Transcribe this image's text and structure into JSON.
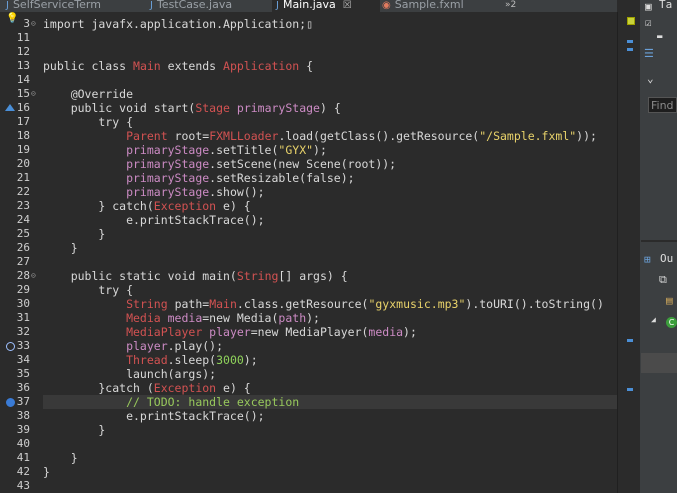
{
  "tabs": [
    {
      "label": "SelfServiceTerm",
      "icon": "java-file-icon",
      "active": false
    },
    {
      "label": "TestCase.java",
      "icon": "java-file-icon",
      "active": false
    },
    {
      "label": "Main.java",
      "icon": "java-file-icon",
      "active": true,
      "close": "☒"
    },
    {
      "label": "Sample.fxml",
      "icon": "fxml-file-icon",
      "active": false
    }
  ],
  "tab_overflow": "»2",
  "code": [
    {
      "n": "3",
      "fold": "⊝",
      "html": [
        [
          "kw",
          "import javafx.application.Application;"
        ],
        [
          "kw",
          "▯"
        ]
      ]
    },
    {
      "n": "11",
      "html": []
    },
    {
      "n": "12",
      "html": []
    },
    {
      "n": "13",
      "html": [
        [
          "kw",
          "public class "
        ],
        [
          "ty",
          "Main"
        ],
        [
          "kw",
          " extends "
        ],
        [
          "ty",
          "Application"
        ],
        [
          "kw",
          " {"
        ]
      ]
    },
    {
      "n": "14",
      "html": []
    },
    {
      "n": "15",
      "fold": "⊝",
      "html": [
        [
          "an",
          "    @Override"
        ]
      ]
    },
    {
      "n": "16",
      "html": [
        [
          "kw",
          "    public void start("
        ],
        [
          "ty",
          "Stage"
        ],
        [
          "kw",
          " "
        ],
        [
          "fd",
          "primaryStage"
        ],
        [
          "kw",
          ") {"
        ]
      ]
    },
    {
      "n": "17",
      "html": [
        [
          "kw",
          "        try {"
        ]
      ]
    },
    {
      "n": "18",
      "html": [
        [
          "kw",
          "            "
        ],
        [
          "ty",
          "Parent"
        ],
        [
          "kw",
          " root="
        ],
        [
          "ty",
          "FXMLLoader"
        ],
        [
          "kw",
          ".load(getClass().getResource("
        ],
        [
          "st",
          "\"/Sample.fxml\""
        ],
        [
          "kw",
          "));"
        ]
      ]
    },
    {
      "n": "19",
      "html": [
        [
          "fd",
          "            primaryStage"
        ],
        [
          "kw",
          ".setTitle("
        ],
        [
          "st",
          "\"GYX\""
        ],
        [
          "kw",
          ");"
        ]
      ]
    },
    {
      "n": "20",
      "html": [
        [
          "fd",
          "            primaryStage"
        ],
        [
          "kw",
          ".setScene(new Scene(root));"
        ]
      ]
    },
    {
      "n": "21",
      "html": [
        [
          "fd",
          "            primaryStage"
        ],
        [
          "kw",
          ".setResizable(false);"
        ]
      ]
    },
    {
      "n": "22",
      "html": [
        [
          "fd",
          "            primaryStage"
        ],
        [
          "kw",
          ".show();"
        ]
      ]
    },
    {
      "n": "23",
      "html": [
        [
          "kw",
          "        } catch("
        ],
        [
          "ty",
          "Exception"
        ],
        [
          "kw",
          " e) {"
        ]
      ]
    },
    {
      "n": "24",
      "html": [
        [
          "kw",
          "            e.printStackTrace();"
        ]
      ]
    },
    {
      "n": "25",
      "html": [
        [
          "kw",
          "        }"
        ]
      ]
    },
    {
      "n": "26",
      "html": [
        [
          "kw",
          "    }"
        ]
      ]
    },
    {
      "n": "27",
      "html": []
    },
    {
      "n": "28",
      "fold": "⊝",
      "html": [
        [
          "kw",
          "    public static void main("
        ],
        [
          "ty",
          "String"
        ],
        [
          "kw",
          "[] args) {"
        ]
      ]
    },
    {
      "n": "29",
      "html": [
        [
          "kw",
          "        try {"
        ]
      ]
    },
    {
      "n": "30",
      "html": [
        [
          "kw",
          "            "
        ],
        [
          "ty",
          "String"
        ],
        [
          "kw",
          " path="
        ],
        [
          "ty",
          "Main"
        ],
        [
          "kw",
          ".class.getResource("
        ],
        [
          "st",
          "\"gyxmusic.mp3\""
        ],
        [
          "kw",
          ").toURI().toString()"
        ]
      ]
    },
    {
      "n": "31",
      "html": [
        [
          "ty",
          "            Media"
        ],
        [
          "fd",
          " media"
        ],
        [
          "kw",
          "=new Media("
        ],
        [
          "fd",
          "path"
        ],
        [
          "kw",
          ");"
        ]
      ]
    },
    {
      "n": "32",
      "html": [
        [
          "ty",
          "            MediaPlayer"
        ],
        [
          "fd",
          " player"
        ],
        [
          "kw",
          "=new MediaPlayer("
        ],
        [
          "fd",
          "media"
        ],
        [
          "kw",
          ");"
        ]
      ]
    },
    {
      "n": "33",
      "html": [
        [
          "fd",
          "            player"
        ],
        [
          "kw",
          ".play();"
        ]
      ]
    },
    {
      "n": "34",
      "html": [
        [
          "ty",
          "            Thread"
        ],
        [
          "kw",
          ".sleep("
        ],
        [
          "nm",
          "3000"
        ],
        [
          "kw",
          ");"
        ]
      ]
    },
    {
      "n": "35",
      "html": [
        [
          "kw",
          "            launch(args);"
        ]
      ]
    },
    {
      "n": "36",
      "html": [
        [
          "kw",
          "        }catch ("
        ],
        [
          "ty",
          "Exception"
        ],
        [
          "kw",
          " e) {"
        ]
      ]
    },
    {
      "n": "37",
      "hl": true,
      "html": [
        [
          "cm",
          "            // TODO: handle exception"
        ]
      ]
    },
    {
      "n": "38",
      "html": [
        [
          "kw",
          "            e.printStackTrace();"
        ]
      ]
    },
    {
      "n": "39",
      "html": [
        [
          "kw",
          "        }"
        ]
      ]
    },
    {
      "n": "40",
      "html": []
    },
    {
      "n": "41",
      "html": [
        [
          "kw",
          "    }"
        ]
      ]
    },
    {
      "n": "42",
      "html": [
        [
          "kw",
          "}"
        ]
      ]
    },
    {
      "n": "43",
      "html": []
    }
  ],
  "panel": {
    "find_placeholder": "Find",
    "outline_label": "Ou",
    "ta_label": "Ta"
  }
}
